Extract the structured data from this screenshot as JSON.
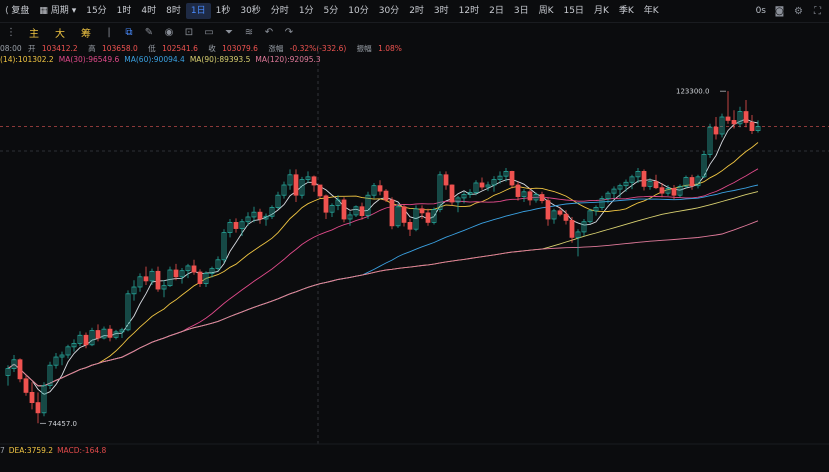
{
  "toolbar": {
    "back_label": "复盘",
    "period_label": "周期",
    "intervals": [
      "15分",
      "1时",
      "4时",
      "8时",
      "1日",
      "1秒",
      "30秒",
      "分时",
      "1分",
      "5分",
      "10分",
      "30分",
      "2时",
      "3时",
      "12时",
      "2日",
      "3日",
      "周K",
      "15日",
      "月K",
      "季K",
      "年K"
    ],
    "active_interval": "1日",
    "countdown": "0s"
  },
  "toolbar2": {
    "indicators": [
      "主",
      "大",
      "筹"
    ]
  },
  "info": {
    "time": "08:00",
    "open_label": "开",
    "open": "103412.2",
    "high_label": "高",
    "high": "103658.0",
    "low_label": "低",
    "low": "102541.6",
    "close_label": "收",
    "close": "103079.6",
    "change_label": "涨幅",
    "change": "-0.32%(-332.6)",
    "amplitude_label": "振幅",
    "amplitude": "1.08%"
  },
  "ma": [
    {
      "text": "(14):101302.2",
      "color": "#f0c542"
    },
    {
      "text": "MA(30):96549.6",
      "color": "#e04a8a"
    },
    {
      "text": "MA(60):90094.4",
      "color": "#3aa0e0"
    },
    {
      "text": "MA(90):89393.5",
      "color": "#d8d070"
    },
    {
      "text": "MA(120):92095.3",
      "color": "#e07a9a"
    }
  ],
  "annotations": {
    "high_price": "123300.0",
    "low_price": "74457.0"
  },
  "indicators_bottom": [
    {
      "text": "7",
      "color": "#9aa0a8"
    },
    {
      "text": "DEA:3759.2",
      "color": "#f0c542"
    },
    {
      "text": "MACD:-164.8",
      "color": "#e04a4a"
    }
  ],
  "colors": {
    "up": "#26a69a",
    "down": "#ef5350",
    "ma_short": "#f0c542",
    "ma30": "#e04a8a",
    "ma60": "#3aa0e0",
    "ma90": "#d8d070",
    "ma120": "#e07a9a",
    "ma_white": "#d8dce2"
  },
  "candles": [
    [
      81500,
      83000,
      80000,
      82500
    ],
    [
      82500,
      84500,
      82000,
      83800
    ],
    [
      83800,
      84000,
      80500,
      81000
    ],
    [
      81000,
      81500,
      78500,
      79000
    ],
    [
      79000,
      80500,
      76500,
      77500
    ],
    [
      77500,
      79000,
      74457,
      76000
    ],
    [
      76000,
      80500,
      75500,
      80000
    ],
    [
      80000,
      83500,
      79500,
      83000
    ],
    [
      83000,
      84800,
      82500,
      84200
    ],
    [
      84200,
      85000,
      83000,
      84500
    ],
    [
      84500,
      86000,
      84000,
      85700
    ],
    [
      85700,
      86800,
      85000,
      86200
    ],
    [
      86200,
      88000,
      85800,
      87400
    ],
    [
      87400,
      87800,
      85500,
      86000
    ],
    [
      86000,
      88500,
      85800,
      88100
    ],
    [
      88100,
      89000,
      86500,
      87000
    ],
    [
      87000,
      88700,
      86800,
      88300
    ],
    [
      88300,
      88900,
      86500,
      87100
    ],
    [
      87100,
      88200,
      86800,
      87900
    ],
    [
      87900,
      88500,
      87000,
      88200
    ],
    [
      88200,
      94000,
      88000,
      93500
    ],
    [
      93500,
      95500,
      92500,
      94500
    ],
    [
      94500,
      96500,
      93800,
      96000
    ],
    [
      96000,
      97500,
      94800,
      95400
    ],
    [
      95400,
      97200,
      94800,
      96800
    ],
    [
      96800,
      97500,
      93800,
      94200
    ],
    [
      94200,
      95500,
      93000,
      94700
    ],
    [
      94700,
      97500,
      94500,
      97000
    ],
    [
      97000,
      97900,
      95500,
      96000
    ],
    [
      96000,
      97300,
      95000,
      96900
    ],
    [
      96900,
      97900,
      95800,
      97600
    ],
    [
      97600,
      98500,
      96300,
      96700
    ],
    [
      96700,
      97100,
      94500,
      95000
    ],
    [
      95000,
      96800,
      94500,
      96500
    ],
    [
      96500,
      97500,
      95900,
      97200
    ],
    [
      97200,
      99000,
      96800,
      98500
    ],
    [
      98500,
      103000,
      98000,
      102500
    ],
    [
      102500,
      104500,
      101800,
      104000
    ],
    [
      104000,
      104600,
      102500,
      103100
    ],
    [
      103100,
      104500,
      102000,
      104100
    ],
    [
      104100,
      105500,
      103500,
      104800
    ],
    [
      104800,
      106300,
      104000,
      105500
    ],
    [
      105500,
      106000,
      103800,
      104500
    ],
    [
      104500,
      105300,
      103500,
      104900
    ],
    [
      104900,
      106500,
      104500,
      106200
    ],
    [
      106200,
      108500,
      105900,
      108000
    ],
    [
      108000,
      110000,
      107500,
      109500
    ],
    [
      109500,
      111800,
      108800,
      111000
    ],
    [
      111000,
      111800,
      107000,
      108000
    ],
    [
      108000,
      110700,
      107500,
      110300
    ],
    [
      110300,
      111500,
      109800,
      110700
    ],
    [
      110700,
      110900,
      108500,
      109500
    ],
    [
      109500,
      108900,
      107500,
      107900
    ],
    [
      107900,
      108100,
      104500,
      105500
    ],
    [
      105500,
      106800,
      104800,
      106500
    ],
    [
      106500,
      108000,
      105800,
      107300
    ],
    [
      107300,
      107700,
      104000,
      104500
    ],
    [
      104500,
      105600,
      103500,
      105100
    ],
    [
      105100,
      106500,
      104800,
      106300
    ],
    [
      106300,
      106900,
      104400,
      105000
    ],
    [
      105000,
      108500,
      104500,
      108000
    ],
    [
      108000,
      109800,
      107500,
      109400
    ],
    [
      109400,
      110200,
      108000,
      108600
    ],
    [
      108600,
      108900,
      107000,
      107300
    ],
    [
      107300,
      107700,
      103000,
      103500
    ],
    [
      103500,
      106800,
      103200,
      106300
    ],
    [
      106300,
      106700,
      103400,
      104000
    ],
    [
      104000,
      104500,
      102000,
      103000
    ],
    [
      103000,
      106500,
      102700,
      106000
    ],
    [
      106000,
      106500,
      104500,
      105400
    ],
    [
      105400,
      106000,
      103500,
      104000
    ],
    [
      104000,
      106200,
      103700,
      105900
    ],
    [
      105900,
      111500,
      105500,
      111000
    ],
    [
      111000,
      111500,
      108800,
      109500
    ],
    [
      109500,
      109600,
      106500,
      107000
    ],
    [
      107000,
      107900,
      105500,
      107600
    ],
    [
      107600,
      108500,
      106800,
      108100
    ],
    [
      108100,
      108900,
      107600,
      108400
    ],
    [
      108400,
      110200,
      108000,
      109800
    ],
    [
      109800,
      110600,
      108800,
      109200
    ],
    [
      109200,
      110000,
      108600,
      109500
    ],
    [
      109500,
      110800,
      108500,
      110300
    ],
    [
      110300,
      111500,
      109700,
      110800
    ],
    [
      110800,
      112000,
      110000,
      111500
    ],
    [
      111500,
      111600,
      109000,
      109500
    ],
    [
      109500,
      110000,
      107200,
      107800
    ],
    [
      107800,
      108900,
      107000,
      108500
    ],
    [
      108500,
      109000,
      106500,
      107300
    ],
    [
      107300,
      108400,
      106900,
      108100
    ],
    [
      108100,
      108500,
      106800,
      107200
    ],
    [
      107200,
      107600,
      103500,
      104500
    ],
    [
      104500,
      106000,
      103800,
      105700
    ],
    [
      105700,
      106300,
      104900,
      105200
    ],
    [
      105200,
      105800,
      103700,
      104300
    ],
    [
      104300,
      104800,
      101000,
      101800
    ],
    [
      101800,
      103000,
      99000,
      102600
    ],
    [
      102600,
      104500,
      102000,
      104100
    ],
    [
      104100,
      106000,
      103800,
      105700
    ],
    [
      105700,
      106500,
      105000,
      106200
    ],
    [
      106200,
      107900,
      105800,
      107500
    ],
    [
      107500,
      108600,
      106800,
      108300
    ],
    [
      108300,
      109300,
      107500,
      108900
    ],
    [
      108900,
      109700,
      107600,
      109400
    ],
    [
      109400,
      110300,
      108500,
      109900
    ],
    [
      109900,
      111000,
      108900,
      110700
    ],
    [
      110700,
      112000,
      109800,
      111500
    ],
    [
      111500,
      111800,
      108700,
      109300
    ],
    [
      109300,
      110500,
      108800,
      110000
    ],
    [
      110000,
      111000,
      108900,
      109100
    ],
    [
      109100,
      109800,
      107700,
      108300
    ],
    [
      108300,
      109500,
      107900,
      109000
    ],
    [
      109000,
      109500,
      107400,
      108000
    ],
    [
      108000,
      109600,
      107700,
      109300
    ],
    [
      109300,
      110900,
      109000,
      110600
    ],
    [
      110600,
      111000,
      108800,
      109400
    ],
    [
      109400,
      111000,
      109000,
      110700
    ],
    [
      110700,
      114500,
      110500,
      114000
    ],
    [
      114000,
      118500,
      113500,
      118000
    ],
    [
      118000,
      119500,
      116200,
      117000
    ],
    [
      117000,
      120000,
      116500,
      119500
    ],
    [
      119500,
      123300,
      118500,
      119000
    ],
    [
      119000,
      120500,
      117800,
      118500
    ],
    [
      118500,
      121000,
      118000,
      120300
    ],
    [
      120300,
      122000,
      118000,
      118700
    ],
    [
      118700,
      119800,
      117000,
      117500
    ],
    [
      117500,
      119000,
      117200,
      118100
    ]
  ]
}
